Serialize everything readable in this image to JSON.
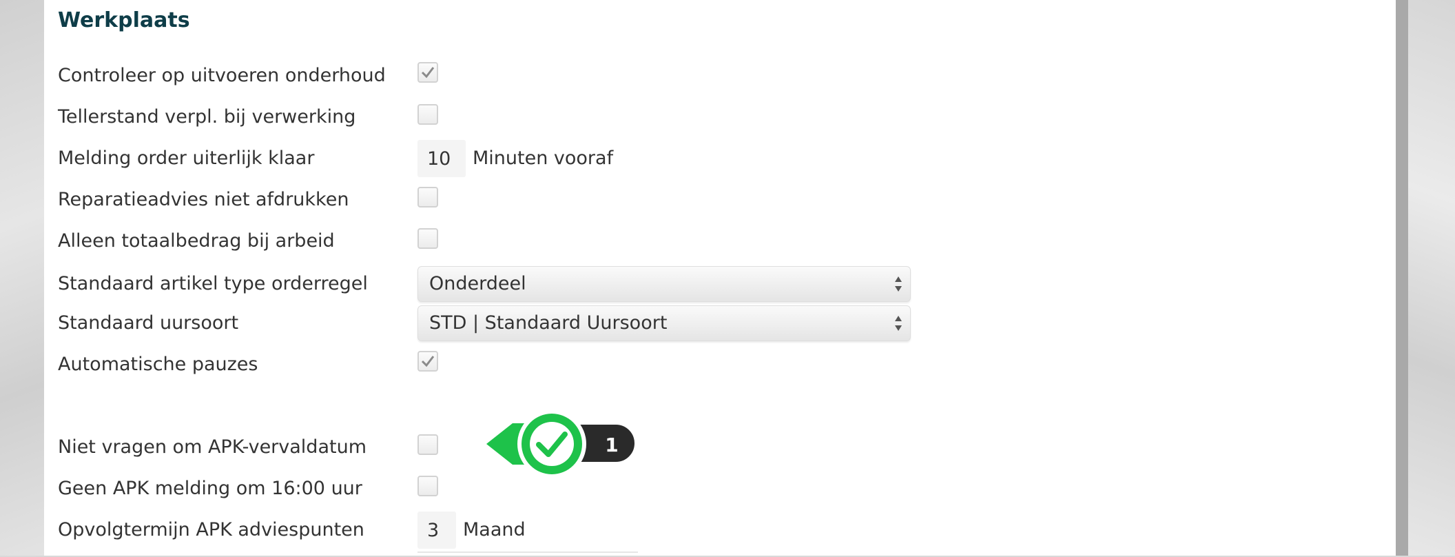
{
  "section": {
    "title": "Werkplaats"
  },
  "settings": {
    "check_maintenance": {
      "label": "Controleer op uitvoeren onderhoud",
      "checked": true
    },
    "odometer_required": {
      "label": "Tellerstand verpl. bij verwerking",
      "checked": false
    },
    "order_ready_notice": {
      "label": "Melding order uiterlijk klaar",
      "value": "10",
      "unit": "Minuten vooraf"
    },
    "no_print_repair_advice": {
      "label": "Reparatieadvies niet afdrukken",
      "checked": false
    },
    "total_only_labor": {
      "label": "Alleen totaalbedrag bij arbeid",
      "checked": false
    },
    "default_article_type": {
      "label": "Standaard artikel type orderregel",
      "selected": "Onderdeel"
    },
    "default_hour_type": {
      "label": "Standaard uursoort",
      "selected": "STD | Standaard Uursoort"
    },
    "automatic_breaks": {
      "label": "Automatische pauzes",
      "checked": true
    },
    "no_apk_expiry_prompt": {
      "label": "Niet vragen om APK-vervaldatum",
      "checked": false
    },
    "no_apk_notice": {
      "label": "Geen APK melding om 16:00 uur",
      "checked": false
    },
    "apk_followup_term": {
      "label": "Opvolgtermijn APK adviespunten",
      "value": "3",
      "unit": "Maand"
    }
  },
  "step_badge": {
    "number": "1",
    "accent": "#1ec24a",
    "dark": "#222222",
    "icon": "check-icon"
  },
  "colors": {
    "title": "#0e3d48",
    "text": "#333333",
    "accent": "#1ec24a"
  }
}
